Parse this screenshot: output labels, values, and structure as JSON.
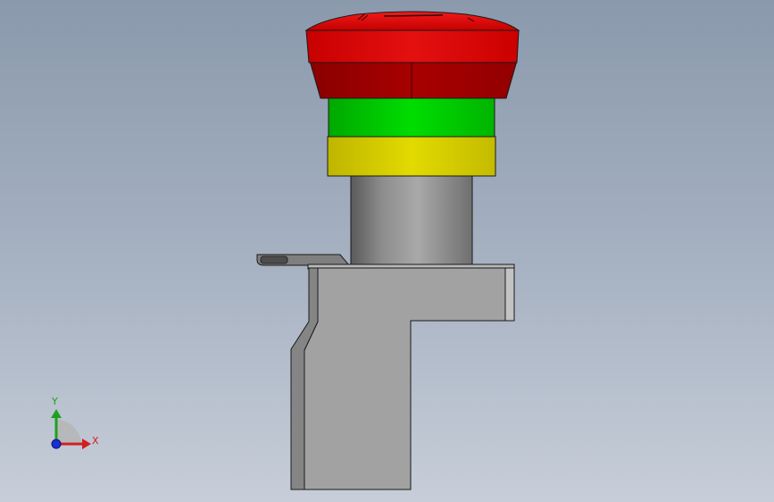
{
  "viewport": {
    "view": "Front",
    "background_top": "#8a99ac",
    "background_bottom": "#c7ced9"
  },
  "model": {
    "parts": [
      {
        "name": "mushroom-cap",
        "color": "#e01010"
      },
      {
        "name": "green-ring",
        "color": "#00cc00"
      },
      {
        "name": "yellow-ring",
        "color": "#d8d200"
      },
      {
        "name": "actuator-stem",
        "color": "#8e8e8e"
      },
      {
        "name": "mounting-bracket",
        "color": "#a2a2a2"
      }
    ]
  },
  "triad": {
    "x_label": "X",
    "y_label": "Y",
    "x_color": "#d02020",
    "y_color": "#20a020",
    "z_color": "#1a2fd8"
  }
}
